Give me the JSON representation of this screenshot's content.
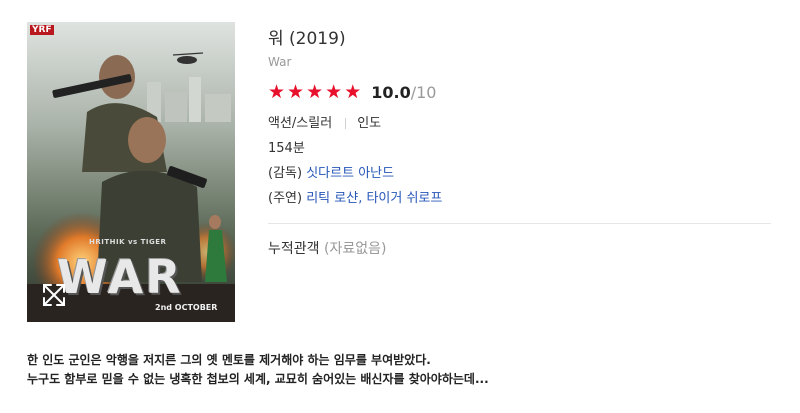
{
  "poster": {
    "logo_text": "WAR",
    "cast_line": "HRITHIK vs TIGER",
    "release_text": "2nd OCTOBER",
    "studio_badge": "YRF",
    "expand_icon": "expand-arrows-icon"
  },
  "movie": {
    "title": "워 (2019)",
    "original_title": "War",
    "rating": {
      "stars_filled": 5,
      "stars_total": 5,
      "score": "10.0",
      "max": "/10",
      "star_color": "#e8112d"
    },
    "genre": "액션/스릴러",
    "country": "인도",
    "runtime": "154분",
    "director_label": "(감독)",
    "director": "싯다르트 아난드",
    "cast_label": "(주연)",
    "cast": "리틱 로샨, 타이거 쉬로프",
    "audience_label": "누적관객",
    "audience_value": "(자료없음)"
  },
  "synopsis": {
    "line1": "한 인도 군인은 악행을 저지른 그의 옛 멘토를 제거해야 하는 임무를 부여받았다.",
    "line2": "누구도 함부로 믿을 수 없는 냉혹한 첩보의 세계, 교묘히 숨어있는 배신자를 찾아야하는데..."
  },
  "colors": {
    "link": "#2656b8",
    "muted": "#999999",
    "text": "#333333"
  }
}
